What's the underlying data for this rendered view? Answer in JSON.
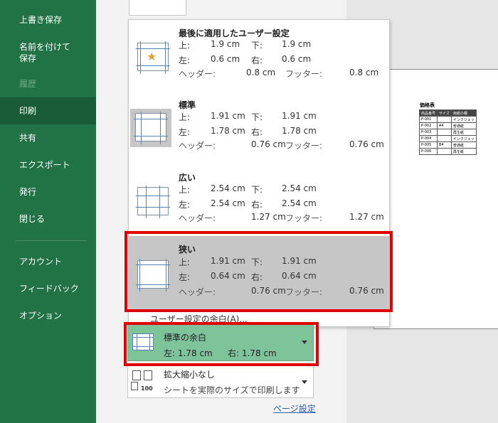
{
  "nav": {
    "items": [
      {
        "label": "上書き保存"
      },
      {
        "label": "名前を付けて\n保存"
      },
      {
        "label": "履歴",
        "disabled": true
      },
      {
        "label": "印刷",
        "active": true
      },
      {
        "label": "共有"
      },
      {
        "label": "エクスポート"
      },
      {
        "label": "発行"
      },
      {
        "label": "閉じる"
      },
      {
        "label": "アカウント"
      },
      {
        "label": "フィードバック"
      },
      {
        "label": "オプション"
      }
    ],
    "bg_color": "#217346"
  },
  "margins_dropdown": {
    "presets": [
      {
        "name": "最後に適用したユーザー設定",
        "icon": "star-margin-icon",
        "top_label": "上:",
        "top_value": "1.9 cm",
        "bottom_label": "下:",
        "bottom_value": "1.9 cm",
        "left_label": "左:",
        "left_value": "0.6 cm",
        "right_label": "右:",
        "right_value": "0.6 cm",
        "header_label": "ヘッダー:",
        "header_value": "0.8 cm",
        "footer_label": "フッター:",
        "footer_value": "0.8 cm"
      },
      {
        "name": "標準",
        "icon": "normal-margin-icon",
        "top_label": "上:",
        "top_value": "1.91 cm",
        "bottom_label": "下:",
        "bottom_value": "1.91 cm",
        "left_label": "左:",
        "left_value": "1.78 cm",
        "right_label": "右:",
        "right_value": "1.78 cm",
        "header_label": "ヘッダー:",
        "header_value": "0.76 cm",
        "footer_label": "フッター:",
        "footer_value": "0.76 cm"
      },
      {
        "name": "広い",
        "icon": "wide-margin-icon",
        "top_label": "上:",
        "top_value": "2.54 cm",
        "bottom_label": "下:",
        "bottom_value": "2.54 cm",
        "left_label": "左:",
        "left_value": "2.54 cm",
        "right_label": "右:",
        "right_value": "2.54 cm",
        "header_label": "ヘッダー:",
        "header_value": "1.27 cm",
        "footer_label": "フッター:",
        "footer_value": "1.27 cm"
      },
      {
        "name": "狭い",
        "icon": "narrow-margin-icon",
        "top_label": "上:",
        "top_value": "1.91 cm",
        "bottom_label": "下:",
        "bottom_value": "1.91 cm",
        "left_label": "左:",
        "left_value": "0.64 cm",
        "right_label": "右:",
        "right_value": "0.64 cm",
        "header_label": "ヘッダー:",
        "header_value": "0.76 cm",
        "footer_label": "フッター:",
        "footer_value": "0.76 cm"
      }
    ],
    "custom_label": "ユーザー設定の余白(A)..."
  },
  "current_margin": {
    "name": "標準の余白",
    "left_text": "左: 1.78 cm",
    "right_text": "右: 1.78 cm",
    "bg_color": "#7ec49a"
  },
  "scaling": {
    "name": "拡大縮小なし",
    "description": "シートを実際のサイズで印刷します",
    "icon_number": "100"
  },
  "page_setup_link": "ページ設定",
  "preview": {
    "title": "価格表",
    "headers": [
      "商品番号",
      "サイズ",
      "用紙の種"
    ],
    "rows": [
      [
        "P-001",
        "",
        "インクジェッ"
      ],
      [
        "P-002",
        "A4",
        "普通紙"
      ],
      [
        "P-003",
        "",
        "再生紙"
      ],
      [
        "P-004",
        "",
        "インクジェッ"
      ],
      [
        "P-005",
        "B4",
        "普通紙"
      ],
      [
        "P-006",
        "",
        "再生紙"
      ]
    ]
  },
  "highlight_color": "#e00000"
}
